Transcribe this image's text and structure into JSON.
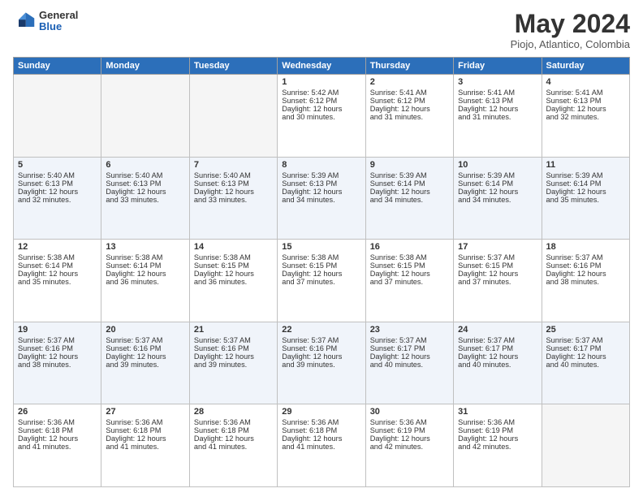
{
  "header": {
    "logo_general": "General",
    "logo_blue": "Blue",
    "month": "May 2024",
    "location": "Piojo, Atlantico, Colombia"
  },
  "days_of_week": [
    "Sunday",
    "Monday",
    "Tuesday",
    "Wednesday",
    "Thursday",
    "Friday",
    "Saturday"
  ],
  "weeks": [
    [
      {
        "day": "",
        "info": ""
      },
      {
        "day": "",
        "info": ""
      },
      {
        "day": "",
        "info": ""
      },
      {
        "day": "1",
        "info": "Sunrise: 5:42 AM\nSunset: 6:12 PM\nDaylight: 12 hours\nand 30 minutes."
      },
      {
        "day": "2",
        "info": "Sunrise: 5:41 AM\nSunset: 6:12 PM\nDaylight: 12 hours\nand 31 minutes."
      },
      {
        "day": "3",
        "info": "Sunrise: 5:41 AM\nSunset: 6:13 PM\nDaylight: 12 hours\nand 31 minutes."
      },
      {
        "day": "4",
        "info": "Sunrise: 5:41 AM\nSunset: 6:13 PM\nDaylight: 12 hours\nand 32 minutes."
      }
    ],
    [
      {
        "day": "5",
        "info": "Sunrise: 5:40 AM\nSunset: 6:13 PM\nDaylight: 12 hours\nand 32 minutes."
      },
      {
        "day": "6",
        "info": "Sunrise: 5:40 AM\nSunset: 6:13 PM\nDaylight: 12 hours\nand 33 minutes."
      },
      {
        "day": "7",
        "info": "Sunrise: 5:40 AM\nSunset: 6:13 PM\nDaylight: 12 hours\nand 33 minutes."
      },
      {
        "day": "8",
        "info": "Sunrise: 5:39 AM\nSunset: 6:13 PM\nDaylight: 12 hours\nand 34 minutes."
      },
      {
        "day": "9",
        "info": "Sunrise: 5:39 AM\nSunset: 6:14 PM\nDaylight: 12 hours\nand 34 minutes."
      },
      {
        "day": "10",
        "info": "Sunrise: 5:39 AM\nSunset: 6:14 PM\nDaylight: 12 hours\nand 34 minutes."
      },
      {
        "day": "11",
        "info": "Sunrise: 5:39 AM\nSunset: 6:14 PM\nDaylight: 12 hours\nand 35 minutes."
      }
    ],
    [
      {
        "day": "12",
        "info": "Sunrise: 5:38 AM\nSunset: 6:14 PM\nDaylight: 12 hours\nand 35 minutes."
      },
      {
        "day": "13",
        "info": "Sunrise: 5:38 AM\nSunset: 6:14 PM\nDaylight: 12 hours\nand 36 minutes."
      },
      {
        "day": "14",
        "info": "Sunrise: 5:38 AM\nSunset: 6:15 PM\nDaylight: 12 hours\nand 36 minutes."
      },
      {
        "day": "15",
        "info": "Sunrise: 5:38 AM\nSunset: 6:15 PM\nDaylight: 12 hours\nand 37 minutes."
      },
      {
        "day": "16",
        "info": "Sunrise: 5:38 AM\nSunset: 6:15 PM\nDaylight: 12 hours\nand 37 minutes."
      },
      {
        "day": "17",
        "info": "Sunrise: 5:37 AM\nSunset: 6:15 PM\nDaylight: 12 hours\nand 37 minutes."
      },
      {
        "day": "18",
        "info": "Sunrise: 5:37 AM\nSunset: 6:16 PM\nDaylight: 12 hours\nand 38 minutes."
      }
    ],
    [
      {
        "day": "19",
        "info": "Sunrise: 5:37 AM\nSunset: 6:16 PM\nDaylight: 12 hours\nand 38 minutes."
      },
      {
        "day": "20",
        "info": "Sunrise: 5:37 AM\nSunset: 6:16 PM\nDaylight: 12 hours\nand 39 minutes."
      },
      {
        "day": "21",
        "info": "Sunrise: 5:37 AM\nSunset: 6:16 PM\nDaylight: 12 hours\nand 39 minutes."
      },
      {
        "day": "22",
        "info": "Sunrise: 5:37 AM\nSunset: 6:16 PM\nDaylight: 12 hours\nand 39 minutes."
      },
      {
        "day": "23",
        "info": "Sunrise: 5:37 AM\nSunset: 6:17 PM\nDaylight: 12 hours\nand 40 minutes."
      },
      {
        "day": "24",
        "info": "Sunrise: 5:37 AM\nSunset: 6:17 PM\nDaylight: 12 hours\nand 40 minutes."
      },
      {
        "day": "25",
        "info": "Sunrise: 5:37 AM\nSunset: 6:17 PM\nDaylight: 12 hours\nand 40 minutes."
      }
    ],
    [
      {
        "day": "26",
        "info": "Sunrise: 5:36 AM\nSunset: 6:18 PM\nDaylight: 12 hours\nand 41 minutes."
      },
      {
        "day": "27",
        "info": "Sunrise: 5:36 AM\nSunset: 6:18 PM\nDaylight: 12 hours\nand 41 minutes."
      },
      {
        "day": "28",
        "info": "Sunrise: 5:36 AM\nSunset: 6:18 PM\nDaylight: 12 hours\nand 41 minutes."
      },
      {
        "day": "29",
        "info": "Sunrise: 5:36 AM\nSunset: 6:18 PM\nDaylight: 12 hours\nand 41 minutes."
      },
      {
        "day": "30",
        "info": "Sunrise: 5:36 AM\nSunset: 6:19 PM\nDaylight: 12 hours\nand 42 minutes."
      },
      {
        "day": "31",
        "info": "Sunrise: 5:36 AM\nSunset: 6:19 PM\nDaylight: 12 hours\nand 42 minutes."
      },
      {
        "day": "",
        "info": ""
      }
    ]
  ]
}
